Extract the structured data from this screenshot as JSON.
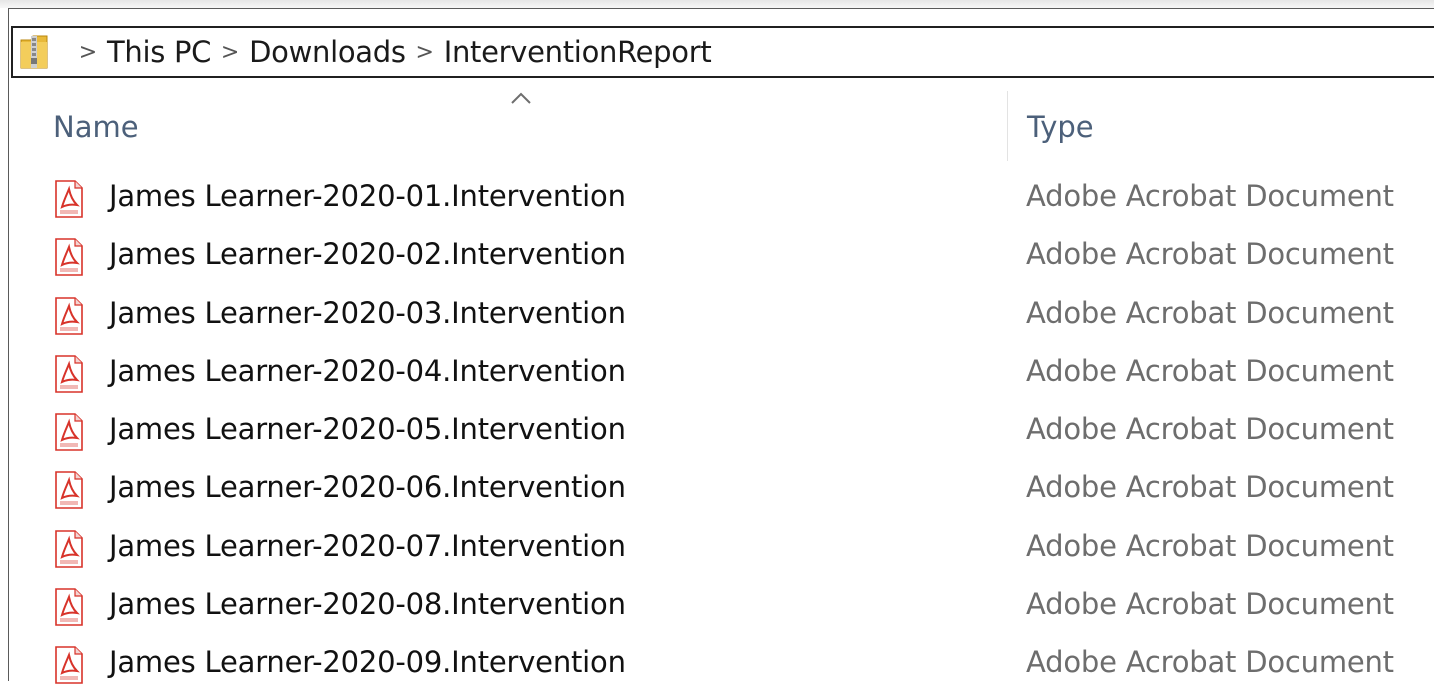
{
  "breadcrumb": {
    "separator": ">",
    "items": [
      "This PC",
      "Downloads",
      "InterventionReport"
    ]
  },
  "columns": {
    "name": "Name",
    "type": "Type",
    "sorted_by": "name",
    "sort_direction": "ascending"
  },
  "files": [
    {
      "name": "James Learner-2020-01.Intervention",
      "type": "Adobe Acrobat Document",
      "icon": "pdf-icon"
    },
    {
      "name": "James Learner-2020-02.Intervention",
      "type": "Adobe Acrobat Document",
      "icon": "pdf-icon"
    },
    {
      "name": "James Learner-2020-03.Intervention",
      "type": "Adobe Acrobat Document",
      "icon": "pdf-icon"
    },
    {
      "name": "James Learner-2020-04.Intervention",
      "type": "Adobe Acrobat Document",
      "icon": "pdf-icon"
    },
    {
      "name": "James Learner-2020-05.Intervention",
      "type": "Adobe Acrobat Document",
      "icon": "pdf-icon"
    },
    {
      "name": "James Learner-2020-06.Intervention",
      "type": "Adobe Acrobat Document",
      "icon": "pdf-icon"
    },
    {
      "name": "James Learner-2020-07.Intervention",
      "type": "Adobe Acrobat Document",
      "icon": "pdf-icon"
    },
    {
      "name": "James Learner-2020-08.Intervention",
      "type": "Adobe Acrobat Document",
      "icon": "pdf-icon"
    },
    {
      "name": "James Learner-2020-09.Intervention",
      "type": "Adobe Acrobat Document",
      "icon": "pdf-icon"
    }
  ],
  "colors": {
    "header_text": "#4c607a",
    "type_text": "#6d6d6d",
    "pdf_red": "#d8332a"
  }
}
